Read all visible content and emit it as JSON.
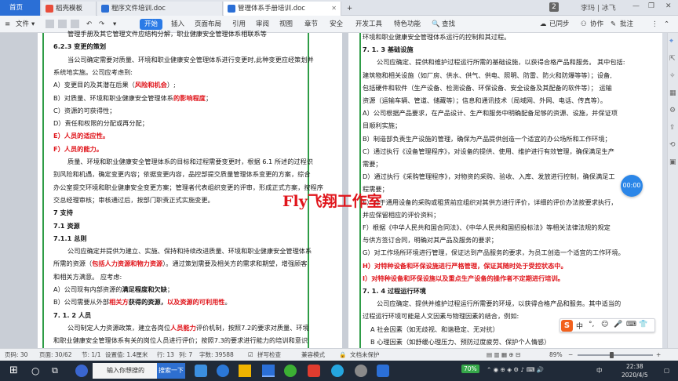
{
  "tabs": {
    "home": "首页",
    "tab1": "稻壳模板",
    "tab2": "程序文件培训.doc",
    "tab3": "管理体系手册培训.doc",
    "badge": "2",
    "user": "李玛 | 冰飞"
  },
  "menu": {
    "file": "文件",
    "start": "开始",
    "insert": "插入",
    "layout": "页面布局",
    "reference": "引用",
    "review": "审阅",
    "view": "视图",
    "chapter": "章节",
    "security": "安全",
    "devtools": "开发工具",
    "features": "特色功能",
    "search": "查找",
    "sync": "已同步",
    "collab": "协作",
    "comment": "批注"
  },
  "left_page": [
    {
      "t": "管理手册及其它管理文件应结构分解，职业健康安全管理体系相联系等",
      "c": ""
    },
    {
      "t": "6.2.3 变更的策划",
      "c": "bold"
    },
    {
      "t": "当公司确定需要对质量、环境和职业健康安全管理体系进行变更时,此种变更应经策划并",
      "c": ""
    },
    {
      "t": "系统地实施。公司应考虑到:",
      "c": ""
    },
    {
      "t": "A）变更目的及其潜在后果（",
      "r": "风险和机会",
      "e": "）;",
      "c": ""
    },
    {
      "t": "B）对质量、环境和职业健康安全管理体系",
      "r": "的影响程度",
      "e": "；",
      "c": ""
    },
    {
      "t": "C）资源的可获得性；",
      "c": ""
    },
    {
      "t": "D）责任和权限的分配或再分配；",
      "c": ""
    },
    {
      "t": "E）人员的适应性。",
      "c": "red"
    },
    {
      "t": "F）人员的能力。",
      "c": "red"
    },
    {
      "t": "质量、环境和职业健康安全管理体系的目标和过程需要变更时，根据 6.1 所述的过程识",
      "c": ""
    },
    {
      "t": "别风险和机遇，确定变更内容；依据变更内容，品控部提交质量管理体系变更的方案，综合",
      "c": ""
    },
    {
      "t": "办公室提交环境和职业健康安全变更方案；管理者代表组织变更的评审，形成正式方案，按程序",
      "c": ""
    },
    {
      "t": "交总经理审核；审核通过后，按部门职责正式实施变更。",
      "c": ""
    },
    {
      "t": "7 支持",
      "c": "bold"
    },
    {
      "t": "7.1 资源",
      "c": "bold"
    },
    {
      "t": "7.1.1 总则",
      "c": "bold"
    },
    {
      "t": "公司应确定并提供为建立、实施、保持和持续改进质量、环境和职业健康安全管理体系",
      "c": ""
    },
    {
      "t": "所需的资源（",
      "r": "包括人力资源和物力资源",
      "e": "）。通过策划需要及相关方的需求和期望，增强顾客",
      "c": ""
    },
    {
      "t": "和相关方满意。 应考虑:",
      "c": ""
    },
    {
      "t": "A）公司现有内部资源的",
      "b": "满足程度和欠缺",
      "e": "；",
      "c": ""
    },
    {
      "t": "B）公司需要从外部",
      "r": "相关方",
      "b": "获得的资源，",
      "r2": "以及资源的可利用性",
      "e": "。",
      "c": ""
    },
    {
      "t": "7. 1. 2 人员",
      "c": "bold"
    },
    {
      "t": "公司制定人力资源政策，建立各岗位",
      "r": "人员能力",
      "e": "评价机制，按照7.2的要求对质量、环境",
      "c": ""
    },
    {
      "t": "和职业健康安全管理体系有关的岗位人员进行评价；按照7.3的要求进行能力的培训和意识",
      "c": ""
    }
  ],
  "right_page": [
    {
      "t": "环境和职业健康安全管理体系运行的控制和其过程。",
      "c": ""
    },
    {
      "t": "7. 1. 3 基础设施",
      "c": "bold"
    },
    {
      "t": "公司应确定、提供和维护过程运行所需的基础设施，以获得合格产品和服务。 其中包括:",
      "c": ""
    },
    {
      "t": "建筑物和相关设施（如厂房、供水、供气、供电、照明、防雷、防火和防爆等等）；设备,",
      "c": ""
    },
    {
      "t": "包括硬件和软件（生产设备、检测设备、环保设备、安全设备及其配备的软件等）； 运输",
      "c": ""
    },
    {
      "t": "资源（运输车辆、管道、储藏等）；信息和通讯技术（局域网、外网、电话、传真等）。",
      "c": ""
    },
    {
      "t": "A）公司根据产品要求，在产品设计、生产和服务中明确配备足够的资源、设施，并保证项",
      "c": ""
    },
    {
      "t": "目顺利实施；",
      "c": ""
    },
    {
      "t": "B）制造部负责生产设施的管理，确保为产品提供创造一个适宜的办公场所和工作环境；",
      "c": ""
    },
    {
      "t": "C）通过执行《设备管理程序》，对设备的提供、使用、维护进行有效管理，确保满足生产",
      "c": ""
    },
    {
      "t": "需要；",
      "c": ""
    },
    {
      "t": "D）通过执行《采购管理程序》，对物资的采购、验收、入库、发放进行控制，确保满足工",
      "c": ""
    },
    {
      "t": "程需要；",
      "c": ""
    },
    {
      "t": "E）对于通用设备的采购或租赁前应组织对其供方进行评价，详细的评价办法按要求执行，",
      "c": ""
    },
    {
      "t": "并应保留相应的评价资料；",
      "c": ""
    },
    {
      "t": "F）根据《中华人民共和国合同法》、《中华人民共和国招投标法》等相关法律法规的规定",
      "c": ""
    },
    {
      "t": "与供方签订合同，明确对其产品及服务的要求；",
      "c": ""
    },
    {
      "t": "G）对工作场所环境进行管理，保证达到产品服务的要求，为员工创造一个适宜的工作环境。",
      "c": ""
    },
    {
      "t": "H）对特种设备和环保设施进行严格管理，保证其随时处于受控状态中。",
      "c": "red"
    },
    {
      "t": "I）对特种设备和环保设施以及重点生产设备的操作者不定期进行培训。",
      "c": "red"
    },
    {
      "t": "7. 1. 4 过程运行环境",
      "c": "bold"
    },
    {
      "t": "公司应确定、提供并维护过程运行所需要的环境，以获得合格产品和服务。其中适当的",
      "c": ""
    },
    {
      "t": "过程运行环境可能是人文因素与物理因素的结合，例如:",
      "c": ""
    },
    {
      "t": "A 社会因素（如无歧视、和谐稳定、无对抗）",
      "c": ""
    },
    {
      "t": "B 心理因素（如舒缓心理压力、预防过度疲劳、保护个人情感）",
      "c": ""
    }
  ],
  "watermark": "Fly飞翔工作室",
  "timer": "00:00",
  "ime": {
    "logo": "S",
    "lang": "中"
  },
  "status": {
    "page": "页码: 30",
    "pages": "页面: 30/62",
    "section": "节: 1/1",
    "setting": "设置值: 1.4厘米",
    "line": "行: 13",
    "col": "列: 7",
    "words": "字数: 39588",
    "spell": "拼写检查",
    "compat": "兼容模式",
    "protect": "文档未保护",
    "zoom": "89%"
  },
  "taskbar": {
    "search": "输入你想搜的",
    "search_btn": "搜索一下",
    "battery": "70%",
    "time": "22:38",
    "date": "2020/4/5",
    "ime": "中"
  }
}
